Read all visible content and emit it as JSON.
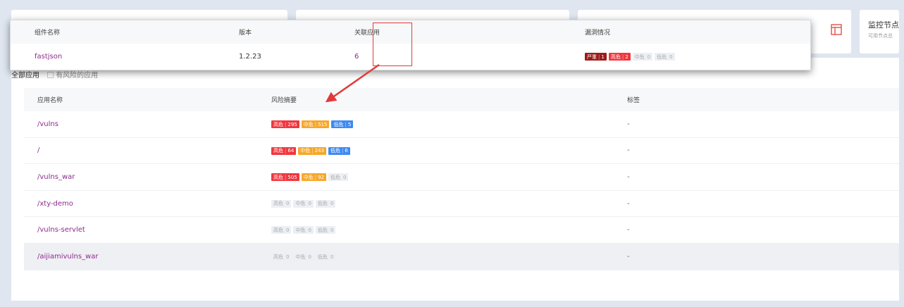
{
  "monitor_card": {
    "title": "监控节点",
    "subtitle": "可用节点总"
  },
  "filter": {
    "all_label": "全部应用",
    "risky_label": "有风险的应用"
  },
  "app_table": {
    "headers": [
      "应用名称",
      "风险摘要",
      "标签"
    ],
    "rows": [
      {
        "name": "/vulns",
        "high": "295",
        "mid": "515",
        "low": "5",
        "tag": "-"
      },
      {
        "name": "/",
        "high": "64",
        "mid": "243",
        "low": "6",
        "tag": "-"
      },
      {
        "name": "/vulns_war",
        "high": "505",
        "mid": "92",
        "low": "0",
        "tag": "-"
      },
      {
        "name": "/xty-demo",
        "high": "0",
        "mid": "0",
        "low": "0",
        "tag": "-"
      },
      {
        "name": "/vulns-servlet",
        "high": "0",
        "mid": "0",
        "low": "0",
        "tag": "-"
      },
      {
        "name": "/aijiamivulns_war",
        "high": "0",
        "mid": "0",
        "low": "0",
        "tag": "-"
      }
    ]
  },
  "risk_labels": {
    "severe": "严重",
    "high": "高危",
    "mid": "中危",
    "low": "低危"
  },
  "popup": {
    "headers": [
      "组件名称",
      "版本",
      "关联应用",
      "漏洞情况"
    ],
    "row": {
      "component": "fastjson",
      "version": "1.2.23",
      "linked_apps": "6",
      "severe": "1",
      "high": "2",
      "mid": "0",
      "low": "0"
    }
  },
  "colors": {
    "high": "#f0373f",
    "mid": "#f7a72a",
    "low": "#3f8af2",
    "severe": "#9b1b1b",
    "annotation": "#e23a3a",
    "link": "#8e2a8e"
  }
}
